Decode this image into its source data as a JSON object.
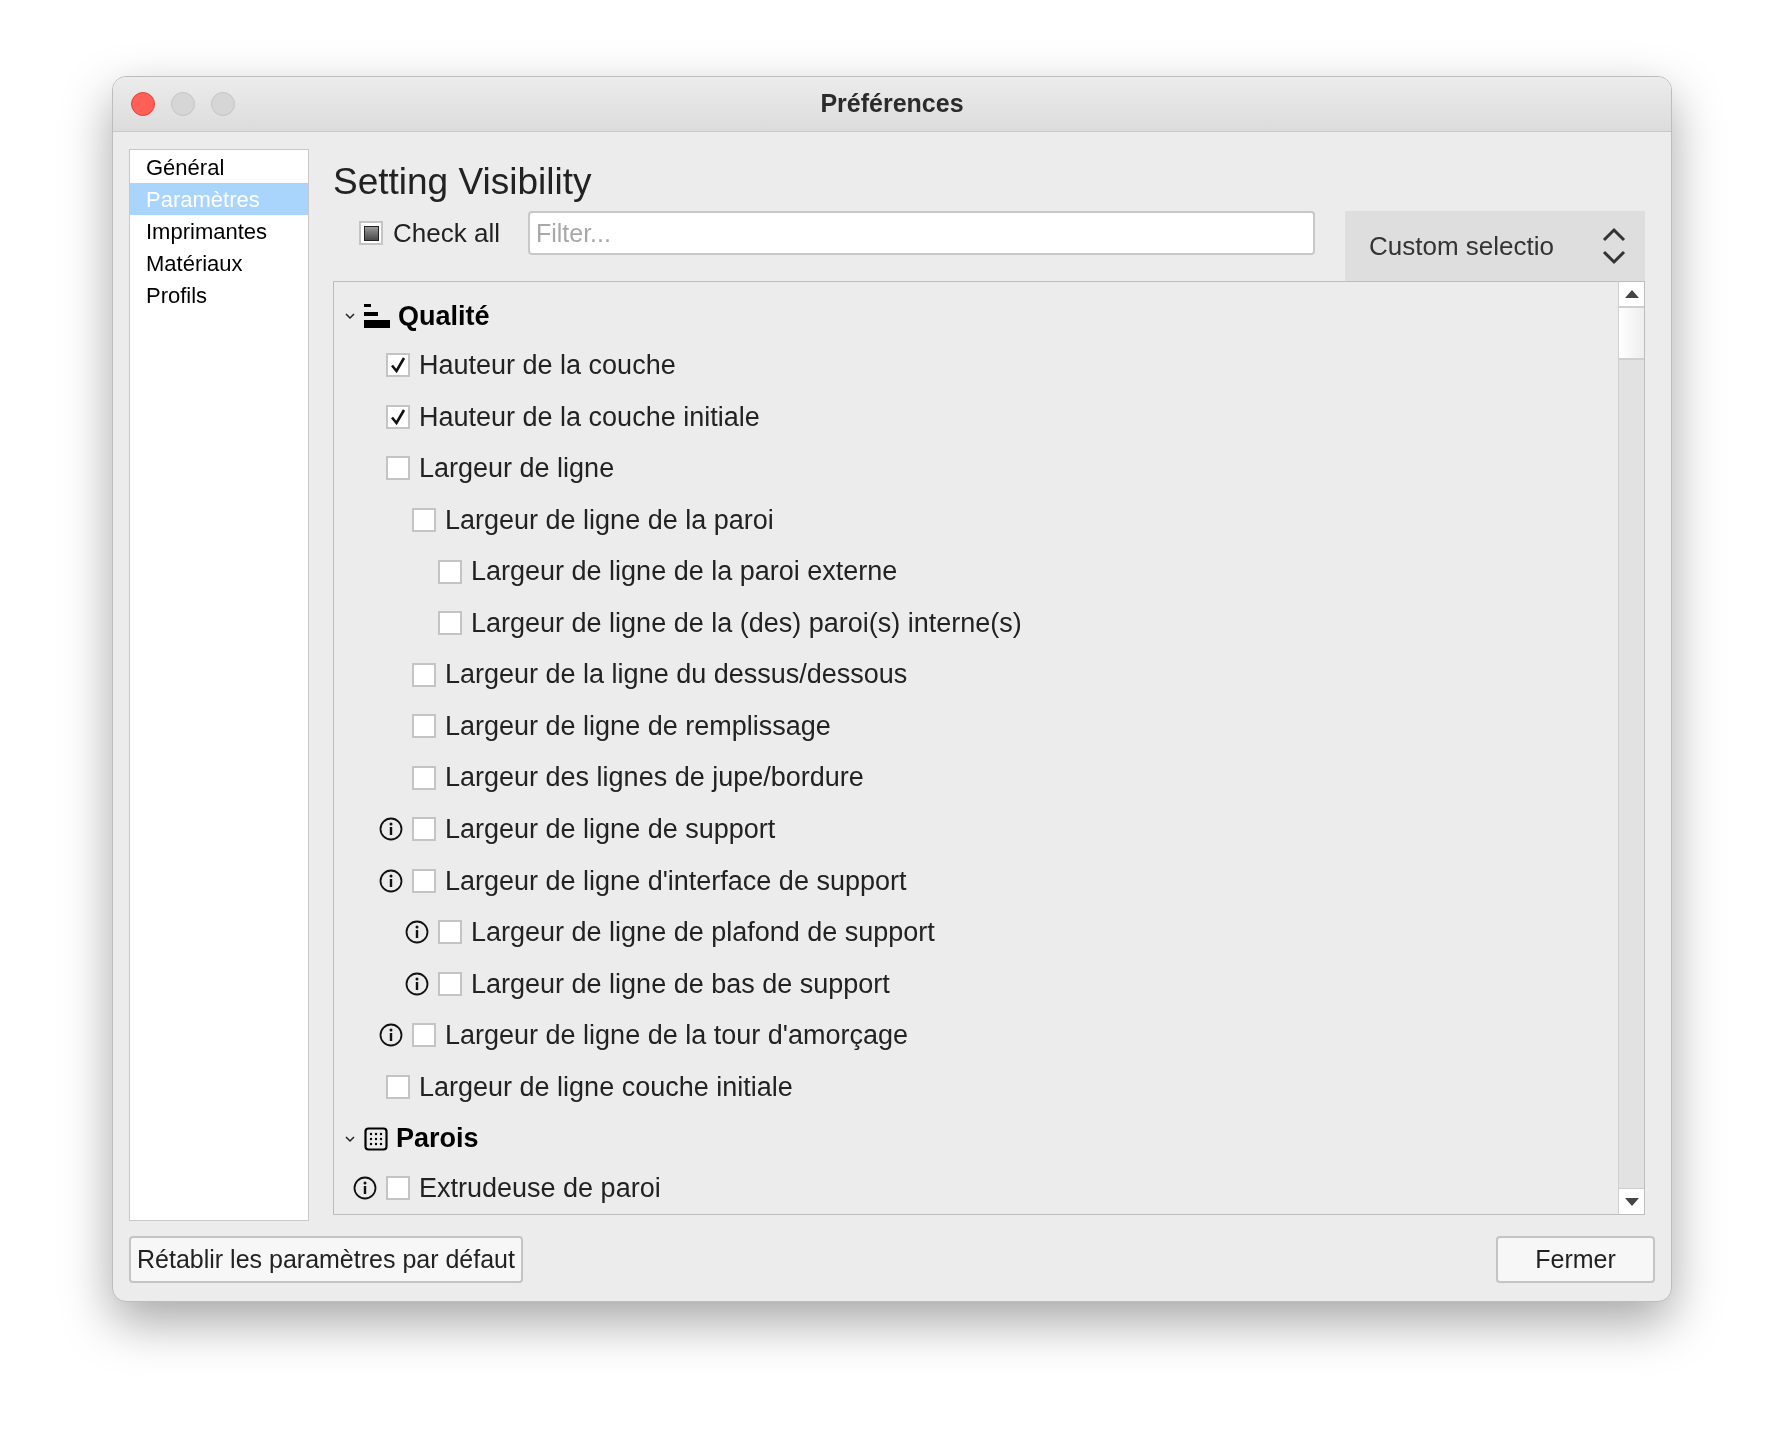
{
  "window": {
    "title": "Préférences"
  },
  "sidebar": {
    "items": [
      {
        "label": "Général",
        "selected": false
      },
      {
        "label": "Paramètres",
        "selected": true
      },
      {
        "label": "Imprimantes",
        "selected": false
      },
      {
        "label": "Matériaux",
        "selected": false
      },
      {
        "label": "Profils",
        "selected": false
      }
    ]
  },
  "heading": "Setting Visibility",
  "check_all": {
    "label": "Check all",
    "checked": false,
    "indeterminate": true
  },
  "filter": {
    "placeholder": "Filter..."
  },
  "preset": {
    "value": "Custom selectio"
  },
  "sections": [
    {
      "title": "Qualité",
      "kind": "layers",
      "expanded": true,
      "settings": [
        {
          "label": "Hauteur de la couche",
          "checked": true,
          "info": false
        },
        {
          "label": "Hauteur de la couche initiale",
          "checked": true,
          "info": false
        },
        {
          "label": "Largeur de ligne",
          "checked": false,
          "info": false,
          "children": [
            {
              "label": "Largeur de ligne de la paroi",
              "checked": false,
              "info": false,
              "children": [
                {
                  "label": "Largeur de ligne de la paroi externe",
                  "checked": false,
                  "info": false
                },
                {
                  "label": "Largeur de ligne de la (des) paroi(s) interne(s)",
                  "checked": false,
                  "info": false
                }
              ]
            },
            {
              "label": "Largeur de la ligne du dessus/dessous",
              "checked": false,
              "info": false
            },
            {
              "label": "Largeur de ligne de remplissage",
              "checked": false,
              "info": false
            },
            {
              "label": "Largeur des lignes de jupe/bordure",
              "checked": false,
              "info": false
            },
            {
              "label": "Largeur de ligne de support",
              "checked": false,
              "info": true
            },
            {
              "label": "Largeur de ligne d'interface de support",
              "checked": false,
              "info": true,
              "children": [
                {
                  "label": "Largeur de ligne de plafond de support",
                  "checked": false,
                  "info": true
                },
                {
                  "label": "Largeur de ligne de bas de support",
                  "checked": false,
                  "info": true
                }
              ]
            },
            {
              "label": "Largeur de ligne de la tour d'amorçage",
              "checked": false,
              "info": true
            }
          ]
        },
        {
          "label": "Largeur de ligne couche initiale",
          "checked": false,
          "info": false
        }
      ]
    },
    {
      "title": "Parois",
      "kind": "grid",
      "expanded": true,
      "settings": [
        {
          "label": "Extrudeuse de paroi",
          "checked": false,
          "info": true
        }
      ]
    }
  ],
  "buttons": {
    "reset": "Rétablir les paramètres par défaut",
    "close": "Fermer"
  }
}
